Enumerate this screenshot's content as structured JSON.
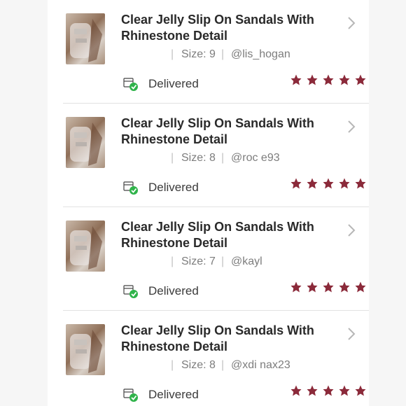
{
  "items": [
    {
      "title": "Clear Jelly Slip On Sandals With Rhinestone Detail",
      "separator": "|",
      "size": "Size: 9",
      "separator2": "|",
      "user": "@lis_hogan",
      "status": "Delivered",
      "rating": 5
    },
    {
      "title": "Clear Jelly Slip On Sandals With Rhinestone Detail",
      "separator": "|",
      "size": "Size: 8",
      "separator2": "|",
      "user": "@roc e93",
      "status": "Delivered",
      "rating": 5
    },
    {
      "title": "Clear Jelly Slip On Sandals With Rhinestone Detail",
      "separator": "|",
      "size": "Size: 7",
      "separator2": "|",
      "user": "@kayl",
      "status": "Delivered",
      "rating": 5
    },
    {
      "title": "Clear Jelly Slip On Sandals With Rhinestone Detail",
      "separator": "|",
      "size": "Size: 8",
      "separator2": "|",
      "user": "@xdi nax23",
      "status": "Delivered",
      "rating": 5
    }
  ],
  "icons": {
    "chevron": "chevron-right-icon",
    "status": "package-delivered-icon",
    "star": "star-icon"
  },
  "colors": {
    "star": "#8b2a3a",
    "check": "#2fb34a",
    "title": "#2a2a2a",
    "meta": "#7d7d7d"
  }
}
